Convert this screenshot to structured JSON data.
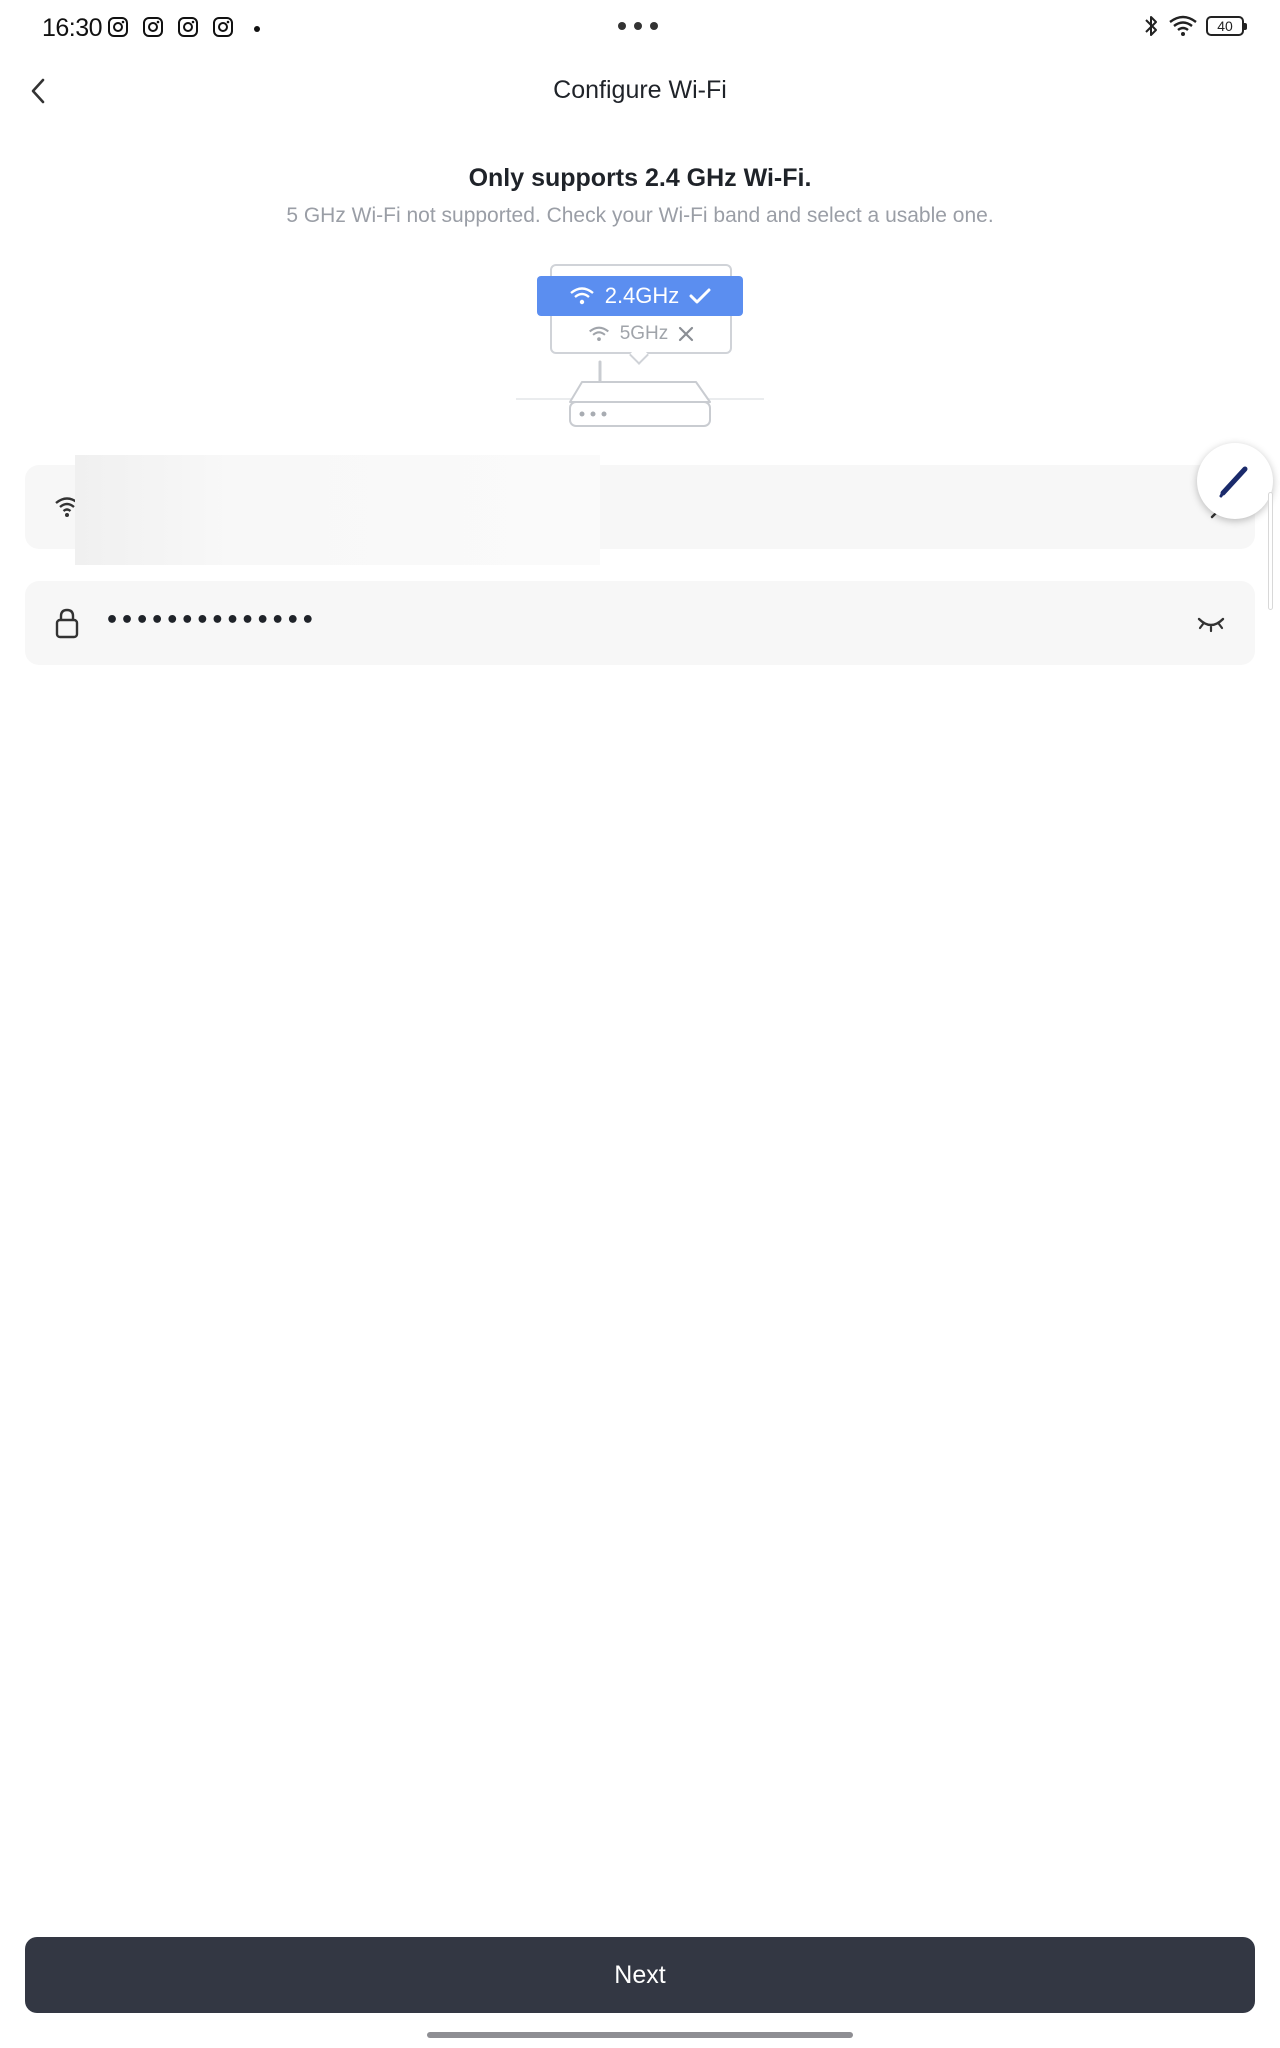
{
  "status_bar": {
    "time": "16:30",
    "app_icons": [
      "instagram-icon",
      "instagram-icon",
      "instagram-icon",
      "instagram-icon"
    ],
    "battery": "40",
    "icons": [
      "bluetooth-icon",
      "wifi-icon",
      "battery-icon"
    ]
  },
  "header": {
    "title": "Configure Wi-Fi"
  },
  "notice": {
    "title": "Only supports 2.4 GHz Wi-Fi.",
    "subtitle": "5 GHz Wi-Fi not supported. Check your Wi-Fi band and select a usable one."
  },
  "illustration": {
    "band_supported": "2.4GHz",
    "band_unsupported": "5GHz",
    "accent_color": "#5b8ef0"
  },
  "wifi_field": {
    "icon": "wifi-icon",
    "value": ""
  },
  "password_field": {
    "icon": "lock-icon",
    "value": "••••••••••••••"
  },
  "actions": {
    "next_label": "Next"
  },
  "colors": {
    "primary_button": "#333743",
    "field_bg": "#f7f7f7"
  }
}
